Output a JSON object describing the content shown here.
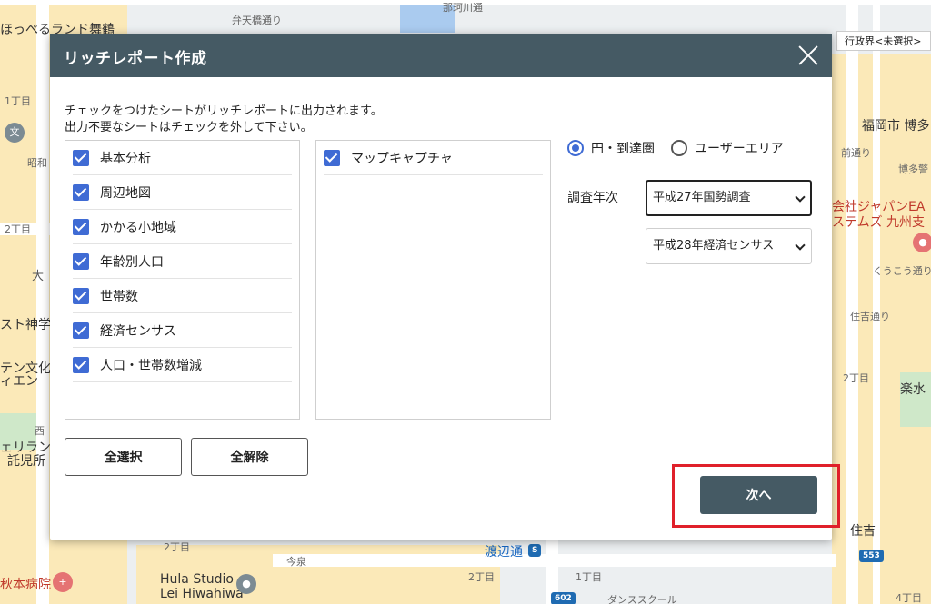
{
  "map": {
    "labels": {
      "hokkaido": "ほっぺるランド舞鶴",
      "benten": "弁天橋通り",
      "kushida": "那珂川通",
      "ch1": "1丁目",
      "showa": "昭和",
      "ch2": "2丁目",
      "dai": "大",
      "shingakuin": "スト神学",
      "tenbun": "テン文化",
      "eien": "ィエン",
      "nishi": "西",
      "elan": "ェリラン",
      "takujisho": "託児所",
      "ch2b": "2丁目",
      "hospital": "秋本病院",
      "hula": "Hula Studio",
      "hula2": "Lei Hiwahiwa",
      "imaizumi": "今泉",
      "watanabe": "渡辺通",
      "ch2c": "2丁目",
      "ch1b": "1丁目",
      "dance": "ダンススクール",
      "fukuoka": "福岡市 博多",
      "hakata": "博多警",
      "jp1": "会社ジャパンEA",
      "jp2": "ステムズ 九州支",
      "kuko": "くうこう通り",
      "sumiyoshi": "住吉通り",
      "ch2d": "2丁目",
      "rakusui": "楽水",
      "sumiyoshi2": "住吉",
      "ch4": "4丁目",
      "maemae": "前通り",
      "shield553": "553",
      "shield602": "602"
    },
    "admin_boundary_label": "行政界<未選択>"
  },
  "dialog": {
    "title": "リッチレポート作成",
    "instructions": [
      "チェックをつけたシートがリッチレポートに出力されます。",
      "出力不要なシートはチェックを外して下さい。"
    ],
    "left_sheets": [
      {
        "label": "基本分析",
        "checked": true
      },
      {
        "label": "周辺地図",
        "checked": true
      },
      {
        "label": "かかる小地域",
        "checked": true
      },
      {
        "label": "年齢別人口",
        "checked": true
      },
      {
        "label": "世帯数",
        "checked": true
      },
      {
        "label": "経済センサス",
        "checked": true
      },
      {
        "label": "人口・世帯数増減",
        "checked": true
      }
    ],
    "right_sheets": [
      {
        "label": "マップキャプチャ",
        "checked": true
      }
    ],
    "area_type": {
      "options": [
        "円・到達圏",
        "ユーザーエリア"
      ],
      "selected": "円・到達圏"
    },
    "survey_year_label": "調査年次",
    "census_select": "平成27年国勢調査",
    "economic_select": "平成28年経済センサス",
    "select_all_label": "全選択",
    "clear_all_label": "全解除",
    "next_label": "次へ",
    "highlight_color": "#e0202a",
    "header_color": "#455a64",
    "checkbox_color": "#3f6bd4"
  }
}
